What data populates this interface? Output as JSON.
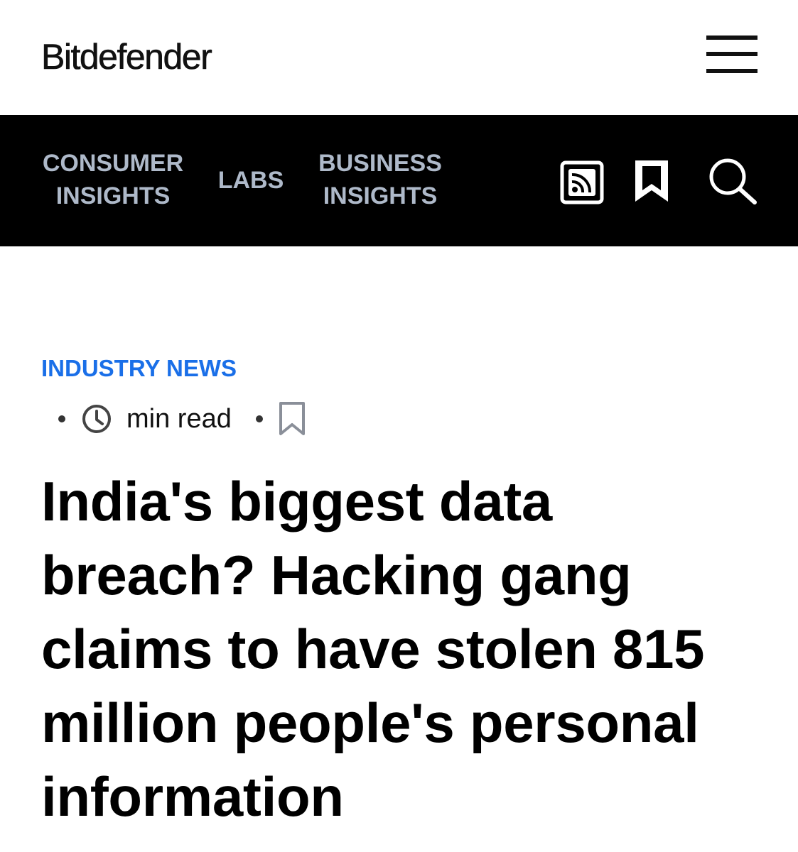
{
  "header": {
    "logo_text": "Bitdefender",
    "menu_icon": "hamburger-menu-icon"
  },
  "nav": {
    "items": [
      {
        "line1": "CONSUMER",
        "line2": "INSIGHTS"
      },
      {
        "line1": "LABS"
      },
      {
        "line1": "BUSINESS",
        "line2": "INSIGHTS"
      }
    ],
    "icons": [
      "rss-feed-icon",
      "bookmark-icon",
      "search-icon"
    ],
    "text_color": "#aeb9c9",
    "background_color": "#000000"
  },
  "article": {
    "category": "INDUSTRY NEWS",
    "category_color": "#1a6fe8",
    "read_time_label": "min read",
    "meta_icons": [
      "clock-icon",
      "bookmark-outline-icon"
    ],
    "headline": "India's biggest data breach? Hacking gang claims to have stolen 815 million people's personal information"
  }
}
